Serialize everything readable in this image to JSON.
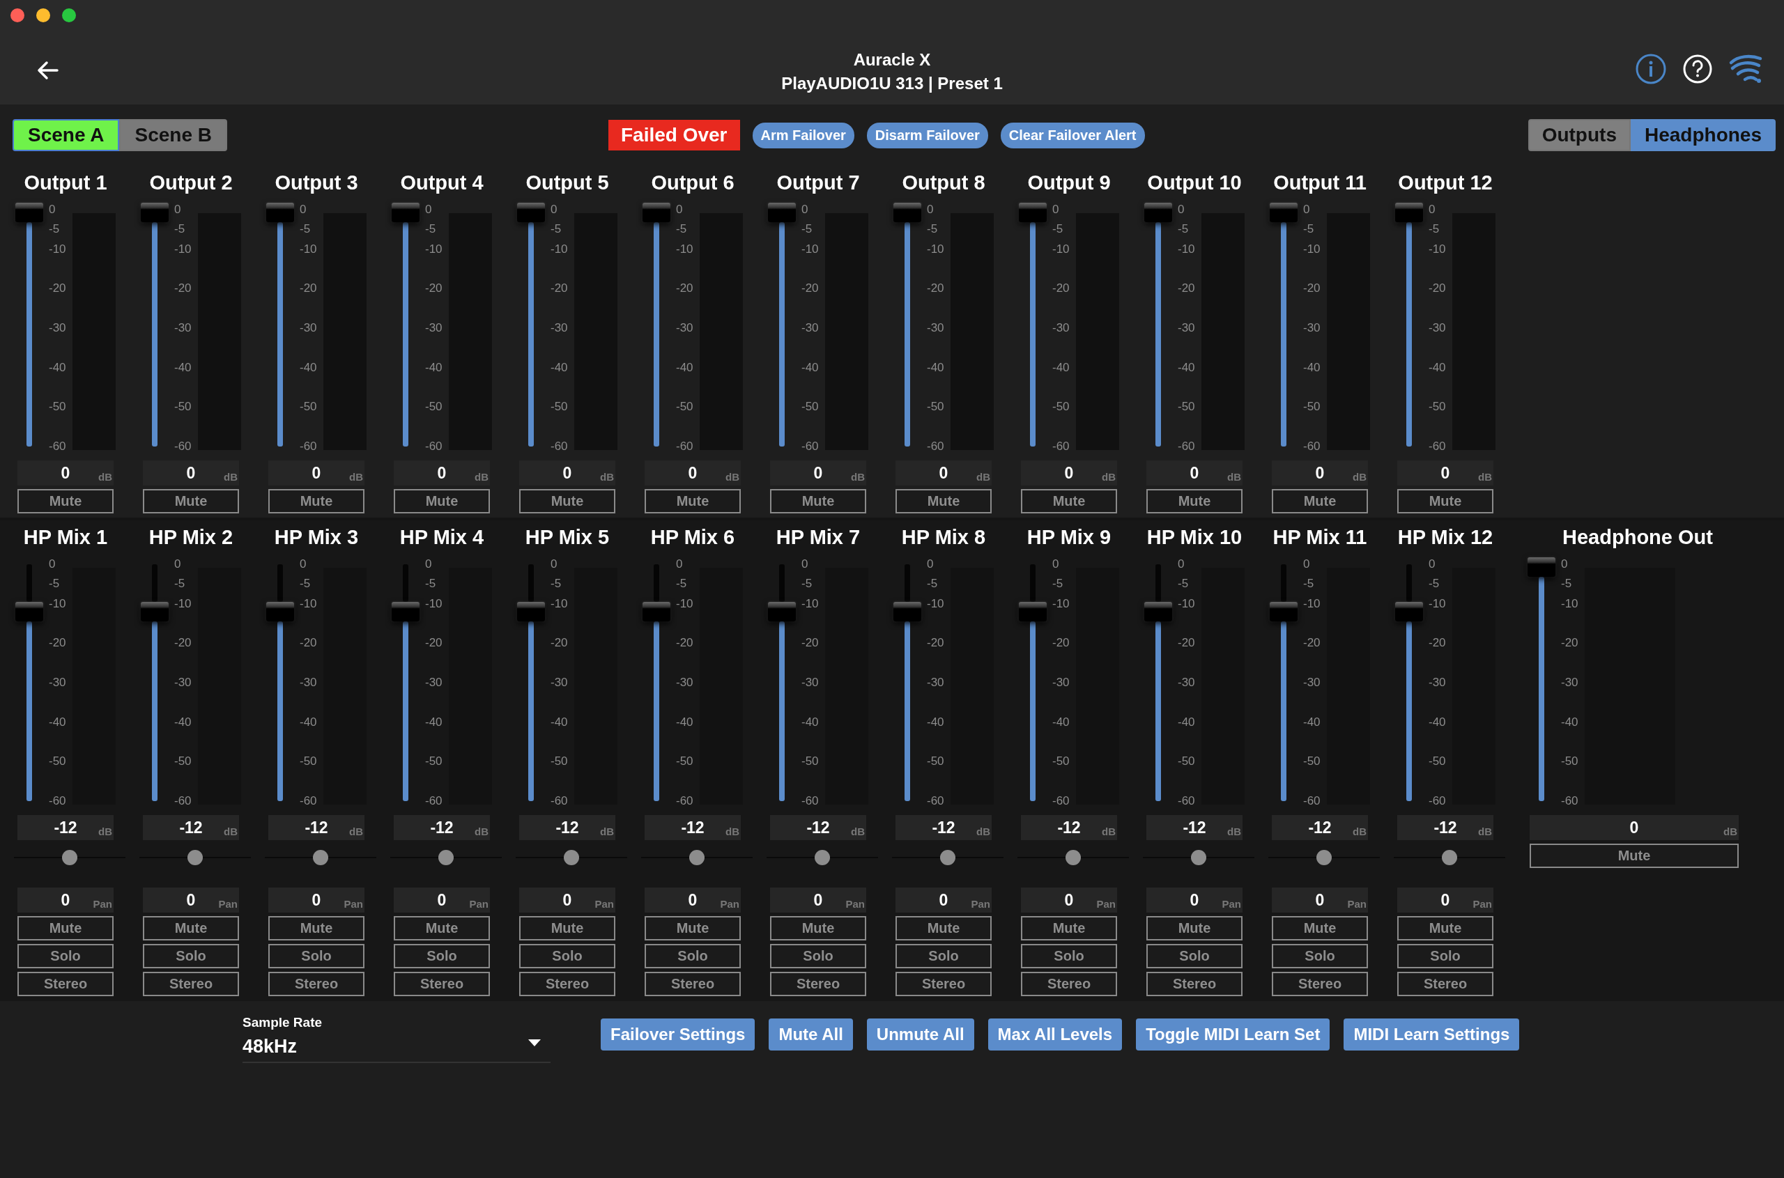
{
  "window": {
    "title": "Auracle X",
    "subtitle": "PlayAUDIO1U 313 | Preset 1"
  },
  "scenes": [
    {
      "label": "Scene A",
      "selected": true
    },
    {
      "label": "Scene B",
      "selected": false
    }
  ],
  "failover": {
    "status": "Failed Over",
    "buttons": [
      "Arm Failover",
      "Disarm Failover",
      "Clear Failover Alert"
    ]
  },
  "views": [
    {
      "label": "Outputs",
      "selected": false
    },
    {
      "label": "Headphones",
      "selected": true
    }
  ],
  "outputs": [
    {
      "name": "Output 1",
      "scale": [
        "0",
        "-5",
        "-10",
        "-20",
        "-30",
        "-40",
        "-50",
        "-60"
      ],
      "level": 1,
      "value": "0",
      "unit": "dB",
      "mute": "Mute"
    },
    {
      "name": "Output 2",
      "scale": [
        "0",
        "-5",
        "-10",
        "-20",
        "-30",
        "-40",
        "-50",
        "-60"
      ],
      "level": 1,
      "value": "0",
      "unit": "dB",
      "mute": "Mute"
    },
    {
      "name": "Output 3",
      "scale": [
        "0",
        "-5",
        "-10",
        "-20",
        "-30",
        "-40",
        "-50",
        "-60"
      ],
      "level": 1,
      "value": "0",
      "unit": "dB",
      "mute": "Mute"
    },
    {
      "name": "Output 4",
      "scale": [
        "0",
        "-5",
        "-10",
        "-20",
        "-30",
        "-40",
        "-50",
        "-60"
      ],
      "level": 1,
      "value": "0",
      "unit": "dB",
      "mute": "Mute"
    },
    {
      "name": "Output 5",
      "scale": [
        "0",
        "-5",
        "-10",
        "-20",
        "-30",
        "-40",
        "-50",
        "-60"
      ],
      "level": 1,
      "value": "0",
      "unit": "dB",
      "mute": "Mute"
    },
    {
      "name": "Output 6",
      "scale": [
        "0",
        "-5",
        "-10",
        "-20",
        "-30",
        "-40",
        "-50",
        "-60"
      ],
      "level": 1,
      "value": "0",
      "unit": "dB",
      "mute": "Mute"
    },
    {
      "name": "Output 7",
      "scale": [
        "0",
        "-5",
        "-10",
        "-20",
        "-30",
        "-40",
        "-50",
        "-60"
      ],
      "level": 1,
      "value": "0",
      "unit": "dB",
      "mute": "Mute"
    },
    {
      "name": "Output 8",
      "scale": [
        "0",
        "-5",
        "-10",
        "-20",
        "-30",
        "-40",
        "-50",
        "-60"
      ],
      "level": 1,
      "value": "0",
      "unit": "dB",
      "mute": "Mute"
    },
    {
      "name": "Output 9",
      "scale": [
        "0",
        "-5",
        "-10",
        "-20",
        "-30",
        "-40",
        "-50",
        "-60"
      ],
      "level": 1,
      "value": "0",
      "unit": "dB",
      "mute": "Mute"
    },
    {
      "name": "Output 10",
      "scale": [
        "0",
        "-5",
        "-10",
        "-20",
        "-30",
        "-40",
        "-50",
        "-60"
      ],
      "level": 1,
      "value": "0",
      "unit": "dB",
      "mute": "Mute"
    },
    {
      "name": "Output 11",
      "scale": [
        "0",
        "-5",
        "-10",
        "-20",
        "-30",
        "-40",
        "-50",
        "-60"
      ],
      "level": 1,
      "value": "0",
      "unit": "dB",
      "mute": "Mute"
    },
    {
      "name": "Output 12",
      "scale": [
        "0",
        "-5",
        "-10",
        "-20",
        "-30",
        "-40",
        "-50",
        "-60"
      ],
      "level": 1,
      "value": "0",
      "unit": "dB",
      "mute": "Mute"
    }
  ],
  "hp_mixes": [
    {
      "name": "HP Mix 1",
      "scale": [
        "0",
        "-5",
        "-10",
        "-20",
        "-30",
        "-40",
        "-50",
        "-60"
      ],
      "level": 0.8,
      "value": "-12",
      "unit": "dB",
      "pan": {
        "level": 0.5,
        "value": "0",
        "unit": "Pan"
      },
      "buttons": [
        "Mute",
        "Solo",
        "Stereo"
      ]
    },
    {
      "name": "HP Mix 2",
      "scale": [
        "0",
        "-5",
        "-10",
        "-20",
        "-30",
        "-40",
        "-50",
        "-60"
      ],
      "level": 0.8,
      "value": "-12",
      "unit": "dB",
      "pan": {
        "level": 0.5,
        "value": "0",
        "unit": "Pan"
      },
      "buttons": [
        "Mute",
        "Solo",
        "Stereo"
      ]
    },
    {
      "name": "HP Mix 3",
      "scale": [
        "0",
        "-5",
        "-10",
        "-20",
        "-30",
        "-40",
        "-50",
        "-60"
      ],
      "level": 0.8,
      "value": "-12",
      "unit": "dB",
      "pan": {
        "level": 0.5,
        "value": "0",
        "unit": "Pan"
      },
      "buttons": [
        "Mute",
        "Solo",
        "Stereo"
      ]
    },
    {
      "name": "HP Mix 4",
      "scale": [
        "0",
        "-5",
        "-10",
        "-20",
        "-30",
        "-40",
        "-50",
        "-60"
      ],
      "level": 0.8,
      "value": "-12",
      "unit": "dB",
      "pan": {
        "level": 0.5,
        "value": "0",
        "unit": "Pan"
      },
      "buttons": [
        "Mute",
        "Solo",
        "Stereo"
      ]
    },
    {
      "name": "HP Mix 5",
      "scale": [
        "0",
        "-5",
        "-10",
        "-20",
        "-30",
        "-40",
        "-50",
        "-60"
      ],
      "level": 0.8,
      "value": "-12",
      "unit": "dB",
      "pan": {
        "level": 0.5,
        "value": "0",
        "unit": "Pan"
      },
      "buttons": [
        "Mute",
        "Solo",
        "Stereo"
      ]
    },
    {
      "name": "HP Mix 6",
      "scale": [
        "0",
        "-5",
        "-10",
        "-20",
        "-30",
        "-40",
        "-50",
        "-60"
      ],
      "level": 0.8,
      "value": "-12",
      "unit": "dB",
      "pan": {
        "level": 0.5,
        "value": "0",
        "unit": "Pan"
      },
      "buttons": [
        "Mute",
        "Solo",
        "Stereo"
      ]
    },
    {
      "name": "HP Mix 7",
      "scale": [
        "0",
        "-5",
        "-10",
        "-20",
        "-30",
        "-40",
        "-50",
        "-60"
      ],
      "level": 0.8,
      "value": "-12",
      "unit": "dB",
      "pan": {
        "level": 0.5,
        "value": "0",
        "unit": "Pan"
      },
      "buttons": [
        "Mute",
        "Solo",
        "Stereo"
      ]
    },
    {
      "name": "HP Mix 8",
      "scale": [
        "0",
        "-5",
        "-10",
        "-20",
        "-30",
        "-40",
        "-50",
        "-60"
      ],
      "level": 0.8,
      "value": "-12",
      "unit": "dB",
      "pan": {
        "level": 0.5,
        "value": "0",
        "unit": "Pan"
      },
      "buttons": [
        "Mute",
        "Solo",
        "Stereo"
      ]
    },
    {
      "name": "HP Mix 9",
      "scale": [
        "0",
        "-5",
        "-10",
        "-20",
        "-30",
        "-40",
        "-50",
        "-60"
      ],
      "level": 0.8,
      "value": "-12",
      "unit": "dB",
      "pan": {
        "level": 0.5,
        "value": "0",
        "unit": "Pan"
      },
      "buttons": [
        "Mute",
        "Solo",
        "Stereo"
      ]
    },
    {
      "name": "HP Mix 10",
      "scale": [
        "0",
        "-5",
        "-10",
        "-20",
        "-30",
        "-40",
        "-50",
        "-60"
      ],
      "level": 0.8,
      "value": "-12",
      "unit": "dB",
      "pan": {
        "level": 0.5,
        "value": "0",
        "unit": "Pan"
      },
      "buttons": [
        "Mute",
        "Solo",
        "Stereo"
      ]
    },
    {
      "name": "HP Mix 11",
      "scale": [
        "0",
        "-5",
        "-10",
        "-20",
        "-30",
        "-40",
        "-50",
        "-60"
      ],
      "level": 0.8,
      "value": "-12",
      "unit": "dB",
      "pan": {
        "level": 0.5,
        "value": "0",
        "unit": "Pan"
      },
      "buttons": [
        "Mute",
        "Solo",
        "Stereo"
      ]
    },
    {
      "name": "HP Mix 12",
      "scale": [
        "0",
        "-5",
        "-10",
        "-20",
        "-30",
        "-40",
        "-50",
        "-60"
      ],
      "level": 0.8,
      "value": "-12",
      "unit": "dB",
      "pan": {
        "level": 0.5,
        "value": "0",
        "unit": "Pan"
      },
      "buttons": [
        "Mute",
        "Solo",
        "Stereo"
      ]
    }
  ],
  "headphone_out": {
    "name": "Headphone Out",
    "scale": [
      "0",
      "-5",
      "-10",
      "-20",
      "-30",
      "-40",
      "-50",
      "-60"
    ],
    "level": 1,
    "value": "0",
    "unit": "dB",
    "mute": "Mute"
  },
  "sample_rate": {
    "label": "Sample Rate",
    "value": "48kHz"
  },
  "actions": [
    "Failover Settings",
    "Mute All",
    "Unmute All",
    "Max All Levels",
    "Toggle MIDI Learn Set",
    "MIDI Learn Settings"
  ]
}
